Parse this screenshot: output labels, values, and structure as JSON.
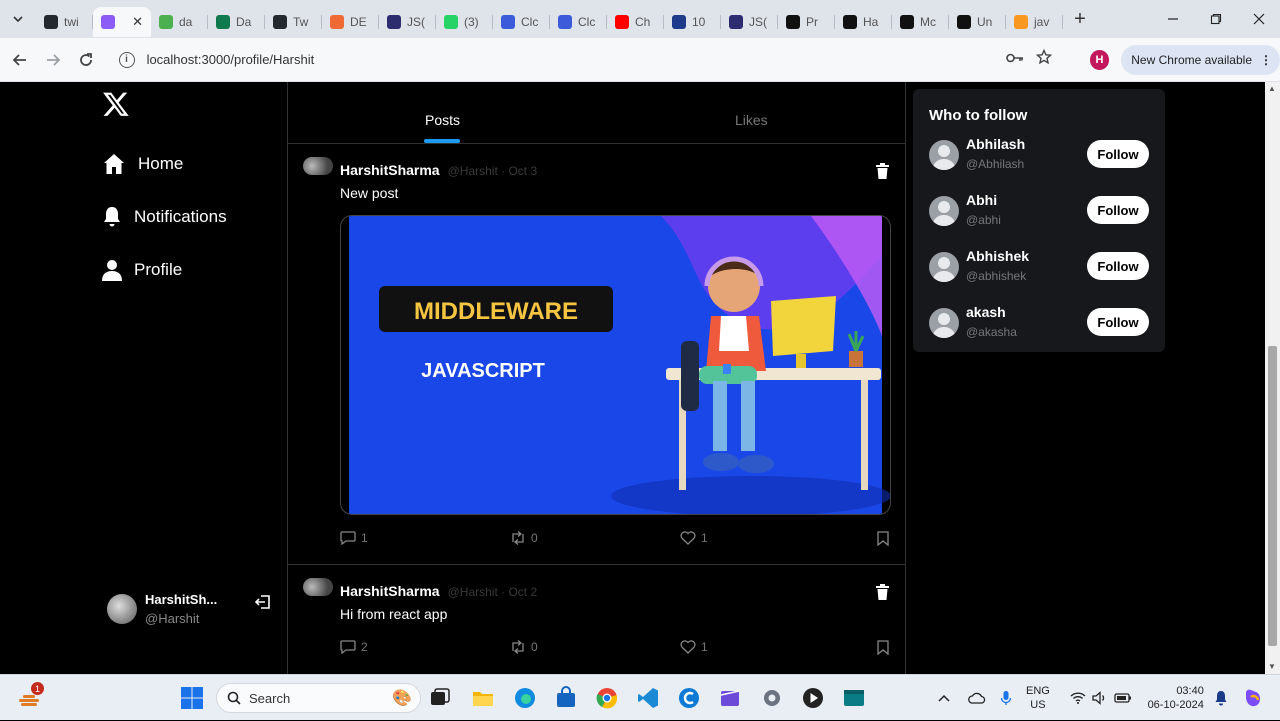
{
  "browser": {
    "tabs": [
      {
        "label": "twi",
        "color": "#24292f"
      },
      {
        "label": "",
        "color": "#8b5cf6",
        "active": true
      },
      {
        "label": "da",
        "color": "#4caf50"
      },
      {
        "label": "Da",
        "color": "#0f7a4e"
      },
      {
        "label": "Tw",
        "color": "#24292f"
      },
      {
        "label": "DE",
        "color": "#f06a35"
      },
      {
        "label": "JS(",
        "color": "#2b2d6e"
      },
      {
        "label": "(3)",
        "color": "#25d366"
      },
      {
        "label": "Clc",
        "color": "#3b5bdb"
      },
      {
        "label": "Clc",
        "color": "#3b5bdb"
      },
      {
        "label": "Ch",
        "color": "#ff0000"
      },
      {
        "label": "10",
        "color": "#1e3a8a"
      },
      {
        "label": "JS(",
        "color": "#2b2d6e"
      },
      {
        "label": "Pr",
        "color": "#111111"
      },
      {
        "label": "Ha",
        "color": "#111111"
      },
      {
        "label": "Mc",
        "color": "#111111"
      },
      {
        "label": "Un",
        "color": "#111111"
      },
      {
        "label": "jav",
        "color": "#f89820"
      }
    ],
    "new_tab": "+",
    "url": "localhost:3000/profile/Harshit",
    "profile_initial": "H",
    "update_label": "New Chrome available"
  },
  "sidebar": {
    "nav": [
      {
        "label": "Home",
        "icon": "home-icon"
      },
      {
        "label": "Notifications",
        "icon": "bell-icon"
      },
      {
        "label": "Profile",
        "icon": "user-icon"
      }
    ],
    "account": {
      "name": "HarshitSh...",
      "handle": "@Harshit"
    }
  },
  "main": {
    "tabs": [
      "Posts",
      "Likes"
    ],
    "active_tab": "Posts",
    "posts": [
      {
        "name": "HarshitSharma",
        "meta": "@Harshit · Oct 3",
        "text": "New post",
        "image": {
          "title": "MIDDLEWARE",
          "subtitle": "JAVASCRIPT"
        },
        "stats": {
          "comments": "1",
          "reposts": "0",
          "likes": "1"
        }
      },
      {
        "name": "HarshitSharma",
        "meta": "@Harshit · Oct 2",
        "text": "Hi from react app",
        "stats": {
          "comments": "2",
          "reposts": "0",
          "likes": "1"
        }
      }
    ]
  },
  "who_to_follow": {
    "title": "Who to follow",
    "button_label": "Follow",
    "users": [
      {
        "name": "Abhilash",
        "handle": "@Abhilash"
      },
      {
        "name": "Abhi",
        "handle": "@abhi"
      },
      {
        "name": "Abhishek",
        "handle": "@abhishek"
      },
      {
        "name": "akash",
        "handle": "@akasha"
      }
    ]
  },
  "taskbar": {
    "search_placeholder": "Search",
    "weather_badge": "1",
    "lang_line1": "ENG",
    "lang_line2": "US",
    "time": "03:40",
    "date": "06-10-2024"
  },
  "colors": {
    "accent": "#1d9bf0",
    "background": "#000000",
    "panel": "#16181c",
    "image_blue": "#1a47e8"
  }
}
